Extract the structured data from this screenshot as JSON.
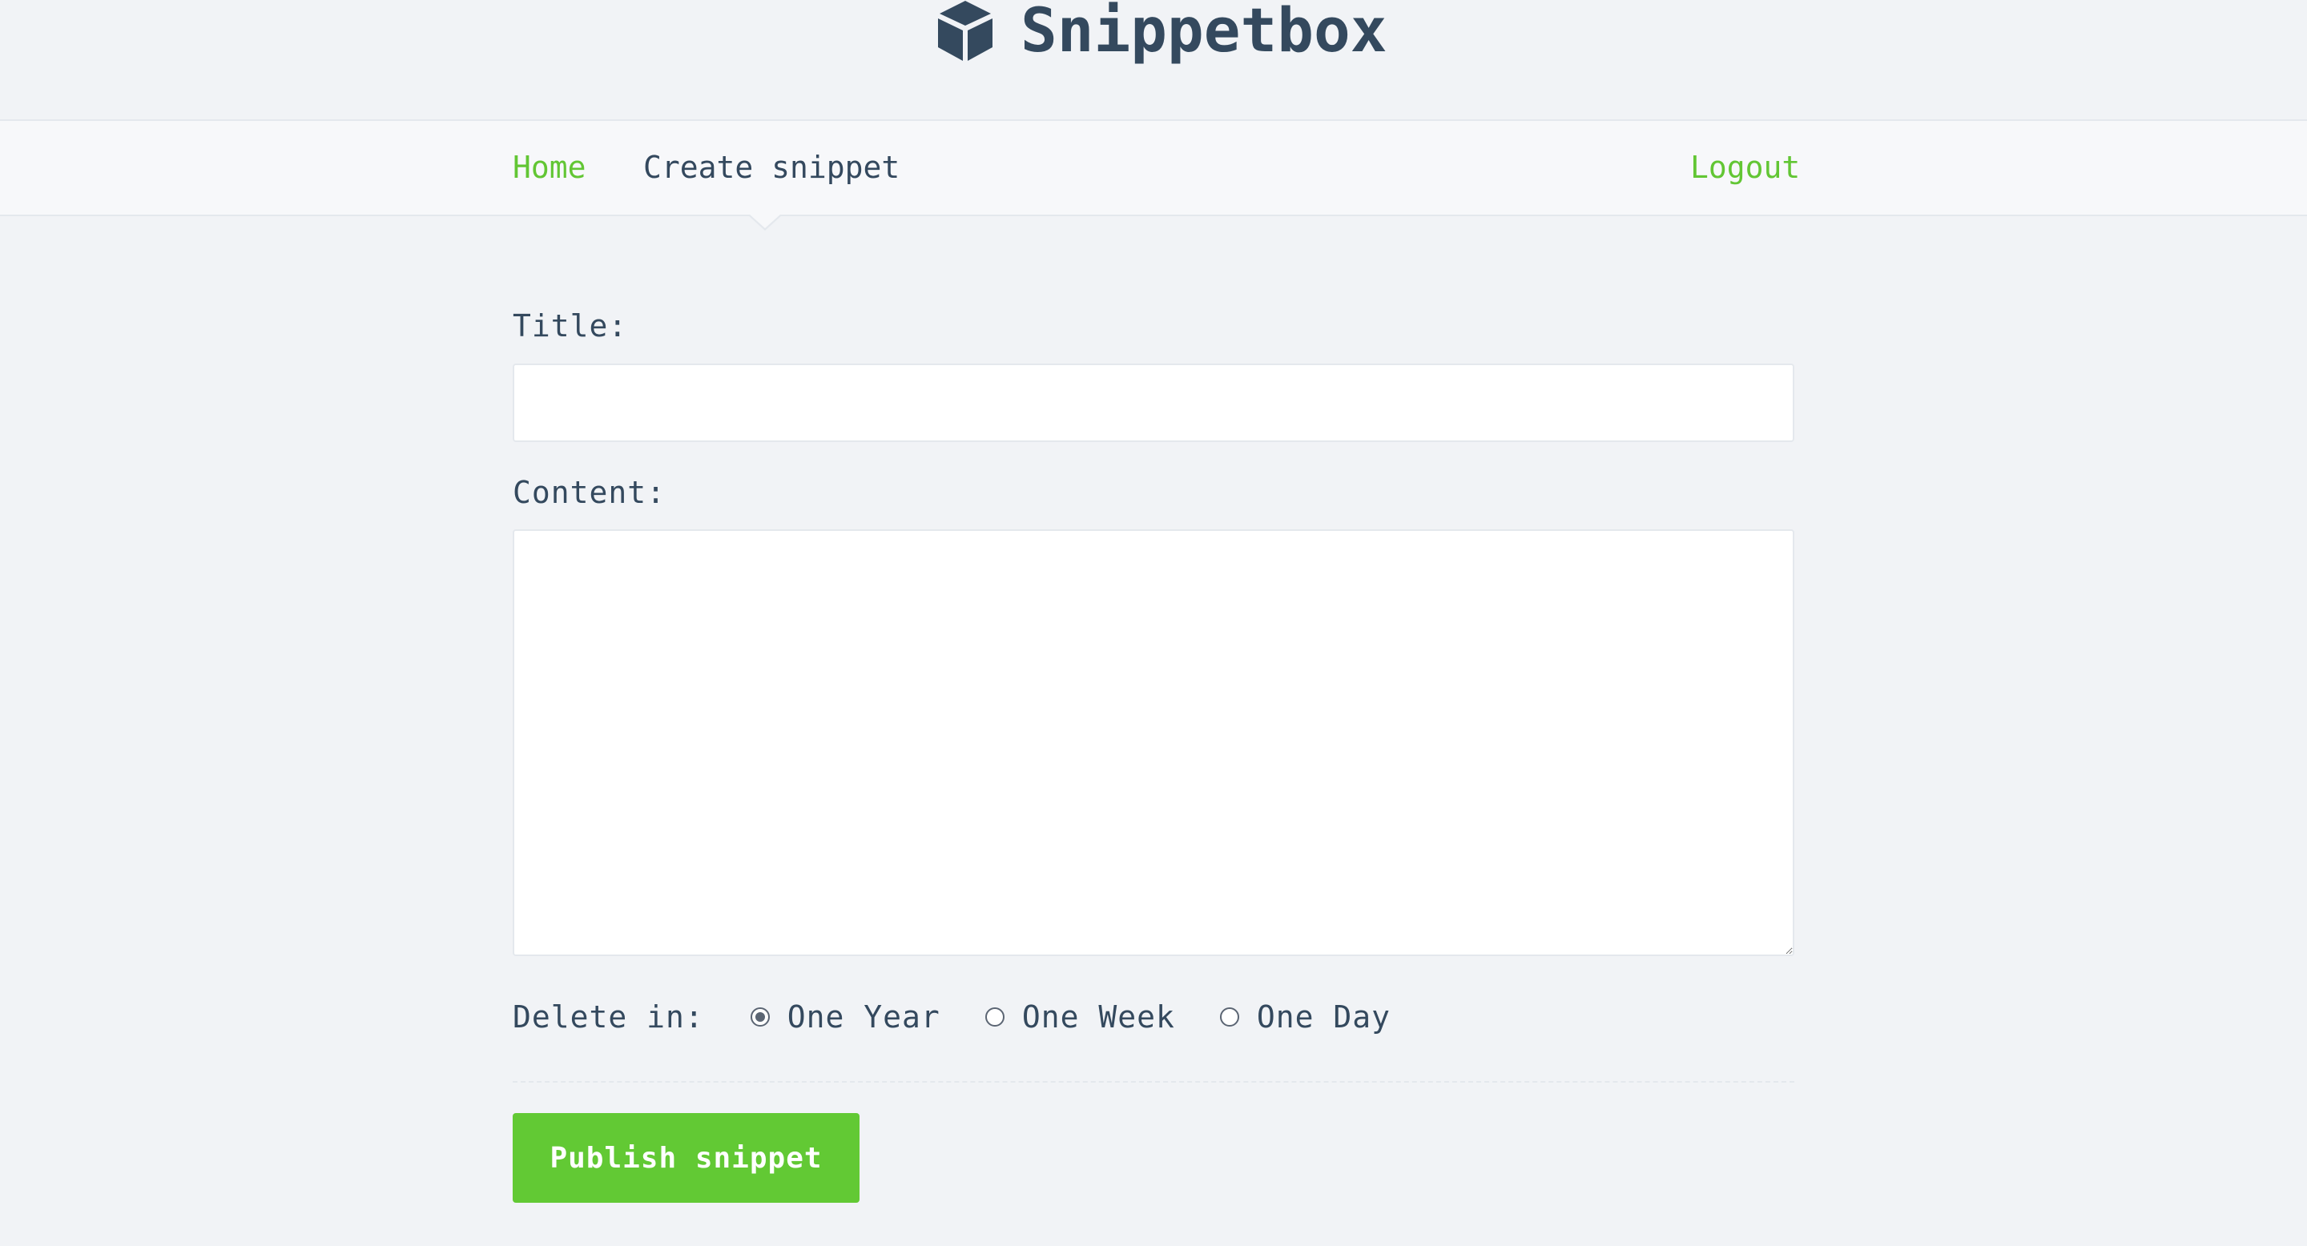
{
  "app": {
    "name": "Snippetbox",
    "logo_icon": "cube-icon"
  },
  "nav": {
    "items": [
      {
        "label": "Home",
        "active": false
      },
      {
        "label": "Create snippet",
        "active": true
      }
    ],
    "logout_label": "Logout"
  },
  "form": {
    "title_label": "Title:",
    "title_value": "",
    "content_label": "Content:",
    "content_value": "",
    "expiry": {
      "label": "Delete in:",
      "selected": "One Year",
      "options": [
        {
          "label": "One Year",
          "checked": true
        },
        {
          "label": "One Week",
          "checked": false
        },
        {
          "label": "One Day",
          "checked": false
        }
      ]
    },
    "submit_label": "Publish snippet"
  },
  "colors": {
    "background": "#f1f3f6",
    "navbar": "#f7f8fa",
    "text": "#34495e",
    "accent": "#62c934"
  }
}
